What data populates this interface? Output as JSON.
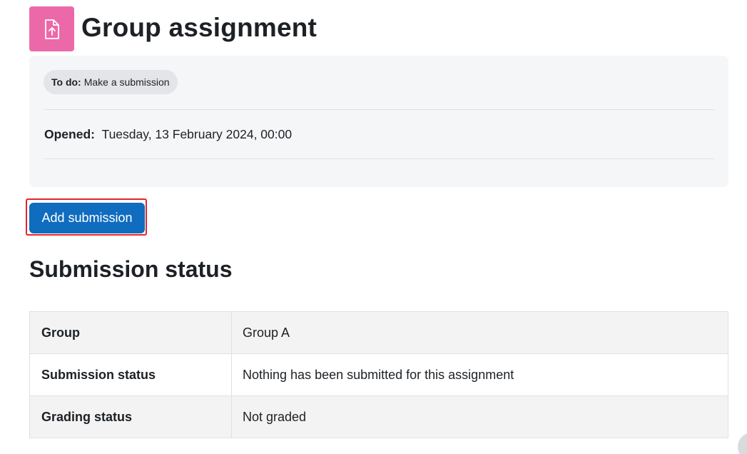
{
  "header": {
    "icon": "file-upload-icon",
    "icon_color": "#ec69a9",
    "title": "Group assignment"
  },
  "activity_info": {
    "todo_key": "To do:",
    "todo_value": "Make a submission",
    "opened_key": "Opened:",
    "opened_value": "Tuesday, 13 February 2024, 00:00"
  },
  "actions": {
    "add_submission_label": "Add submission",
    "button_color": "#0f6cbf",
    "highlight_color": "#e5252a"
  },
  "submission_status": {
    "heading": "Submission status",
    "rows": [
      {
        "label": "Group",
        "value": "Group A"
      },
      {
        "label": "Submission status",
        "value": "Nothing has been submitted for this assignment"
      },
      {
        "label": "Grading status",
        "value": "Not graded"
      }
    ]
  }
}
